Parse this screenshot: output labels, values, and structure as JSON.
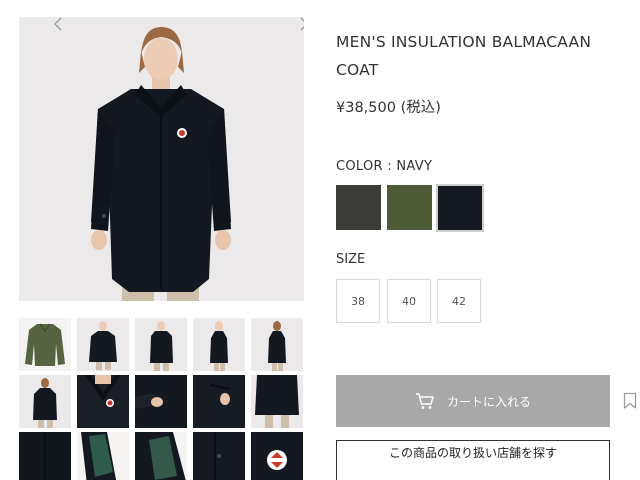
{
  "product": {
    "title_line1": "MEN'S INSULATION BALMACAAN",
    "title_line2": "COAT",
    "price": "¥38,500 (税込)"
  },
  "color": {
    "label": "COLOR : NAVY",
    "swatches": [
      {
        "name": "charcoal",
        "hex": "#3b3c37"
      },
      {
        "name": "olive",
        "hex": "#4e5b37"
      },
      {
        "name": "navy",
        "hex": "#151a22"
      }
    ],
    "selected": "navy"
  },
  "size": {
    "label": "SIZE",
    "options": [
      "38",
      "40",
      "42"
    ]
  },
  "actions": {
    "cart_label": "カートに入れる",
    "store_label": "この商品の取り扱い店舗を探す"
  },
  "icons": {
    "prev": "chevron-left-icon",
    "next": "chevron-right-icon",
    "cart": "cart-icon",
    "bookmark": "bookmark-icon"
  },
  "gallery": {
    "thumbnail_count": 15,
    "selected_index": 0
  }
}
